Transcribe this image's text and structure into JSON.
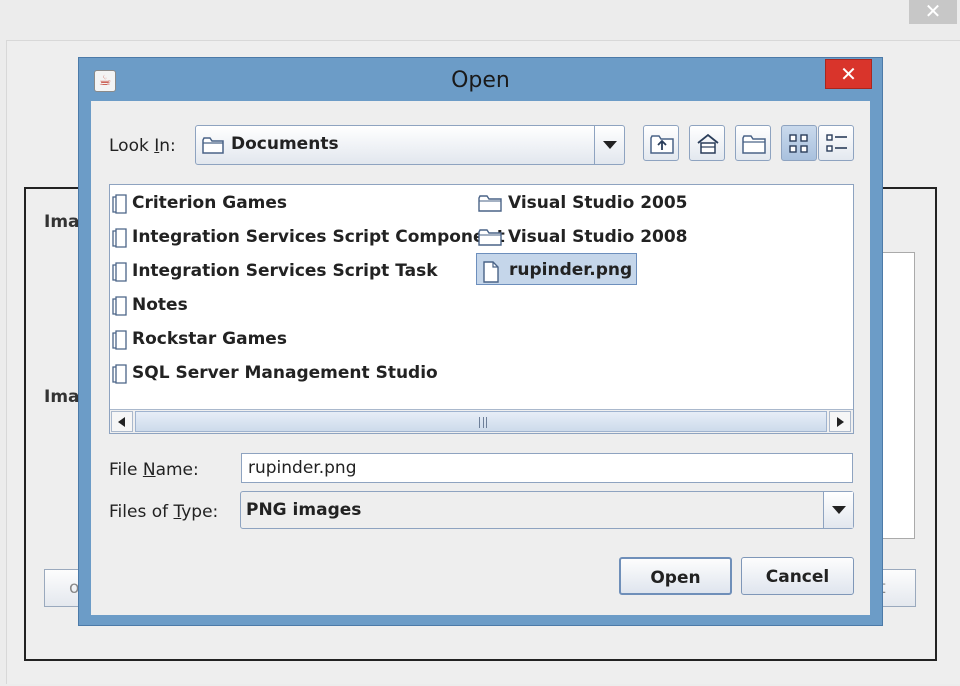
{
  "background": {
    "close_glyph": "✕",
    "label_top": "Ima",
    "label_bottom": "Ima",
    "btn_left_text": "o",
    "btn_right_text": "t"
  },
  "dialog": {
    "title": "Open",
    "close_glyph": "✕",
    "look_in": {
      "label_before": "Look ",
      "label_mnemonic": "I",
      "label_after": "n:",
      "value": "Documents"
    },
    "toolbar_icons": [
      "up-folder-icon",
      "home-icon",
      "new-folder-icon",
      "list-view-icon",
      "details-view-icon"
    ],
    "files": [
      {
        "name": "Criterion Games",
        "kind": "folder"
      },
      {
        "name": "Integration Services Script Component",
        "kind": "folder"
      },
      {
        "name": "Integration Services Script Task",
        "kind": "folder"
      },
      {
        "name": "Notes",
        "kind": "folder"
      },
      {
        "name": "Rockstar Games",
        "kind": "folder"
      },
      {
        "name": "SQL Server Management Studio",
        "kind": "folder"
      },
      {
        "name": "Visual Studio 2005",
        "kind": "folder"
      },
      {
        "name": "Visual Studio 2008",
        "kind": "folder"
      },
      {
        "name": "rupinder.png",
        "kind": "file",
        "selected": true
      }
    ],
    "file_name": {
      "label_before": "File ",
      "label_mnemonic": "N",
      "label_after": "ame:",
      "value": "rupinder.png"
    },
    "file_type": {
      "label_before": "Files of ",
      "label_mnemonic": "T",
      "label_after": "ype:",
      "value": "PNG images"
    },
    "open_label": "Open",
    "cancel_label": "Cancel"
  }
}
